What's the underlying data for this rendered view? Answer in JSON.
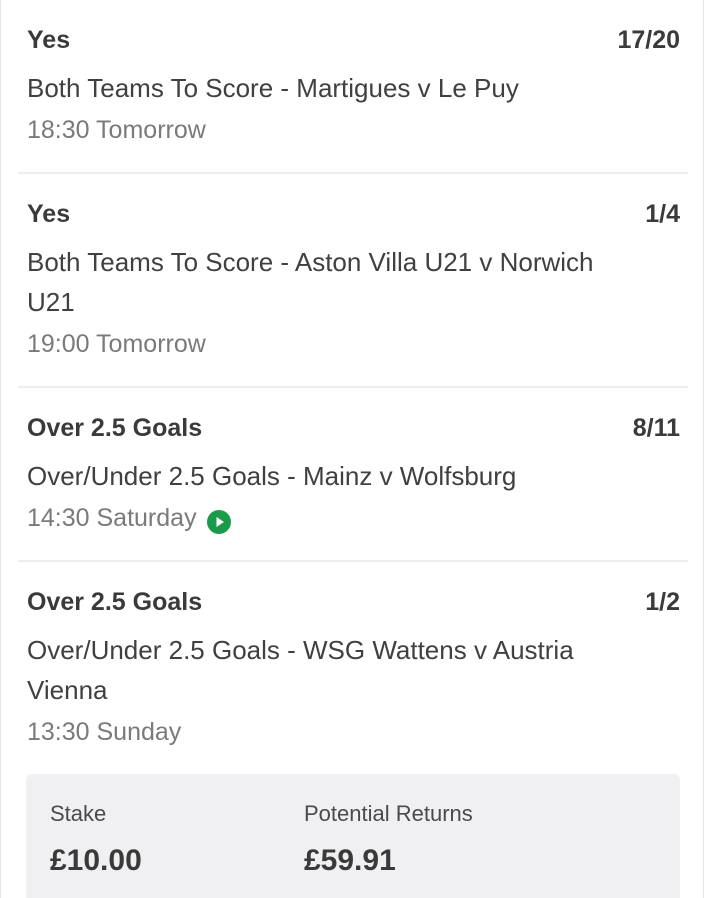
{
  "selections": [
    {
      "name": "Yes",
      "odds": "17/20",
      "market": "Both Teams To Score - Martigues v Le Puy",
      "time": "18:30 Tomorrow",
      "live": false
    },
    {
      "name": "Yes",
      "odds": "1/4",
      "market": "Both Teams To Score - Aston Villa U21 v Norwich U21",
      "time": "19:00 Tomorrow",
      "live": false
    },
    {
      "name": "Over 2.5 Goals",
      "odds": "8/11",
      "market": "Over/Under 2.5 Goals - Mainz v Wolfsburg",
      "time": "14:30 Saturday",
      "live": true
    },
    {
      "name": "Over 2.5 Goals",
      "odds": "1/2",
      "market": "Over/Under 2.5 Goals - WSG Wattens v Austria Vienna",
      "time": "13:30 Sunday",
      "live": false
    }
  ],
  "summary": {
    "stake_label": "Stake",
    "stake_value": "£10.00",
    "returns_label": "Potential Returns",
    "returns_value": "£59.91"
  },
  "colors": {
    "live_icon": "#1a9b4b",
    "summary_bg": "#f0f0f2"
  },
  "icons": {
    "live": "play-circle-icon"
  }
}
